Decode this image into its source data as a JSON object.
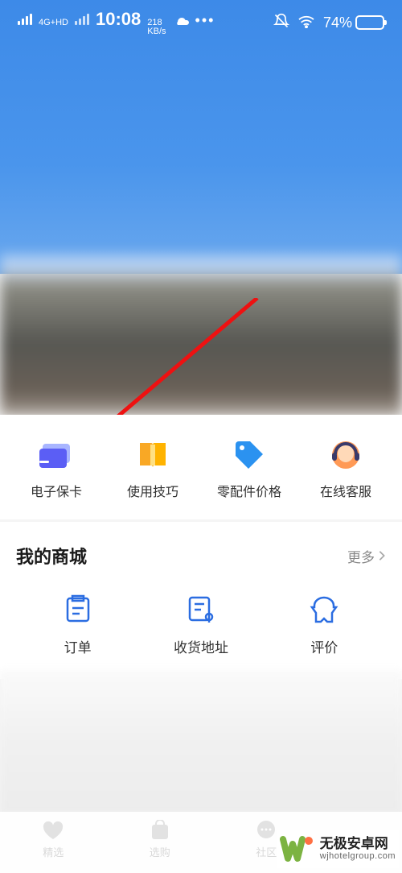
{
  "status": {
    "network_label": "4G+HD",
    "time": "10:08",
    "netspeed_value": "218",
    "netspeed_unit": "KB/s",
    "battery_label": "74%"
  },
  "quick_grid": [
    {
      "label": "电子保卡",
      "icon": "card-icon"
    },
    {
      "label": "使用技巧",
      "icon": "book-icon"
    },
    {
      "label": "零配件价格",
      "icon": "tag-icon"
    },
    {
      "label": "在线客服",
      "icon": "agent-icon"
    }
  ],
  "mall": {
    "title": "我的商城",
    "more_label": "更多",
    "items": [
      {
        "label": "订单",
        "icon": "order-icon"
      },
      {
        "label": "收货地址",
        "icon": "address-icon"
      },
      {
        "label": "评价",
        "icon": "review-icon"
      }
    ]
  },
  "tabs": [
    {
      "label": "精选",
      "icon": "heart-icon"
    },
    {
      "label": "选购",
      "icon": "bag-icon"
    },
    {
      "label": "社区",
      "icon": "chat-icon"
    }
  ],
  "watermark": {
    "title": "无极安卓网",
    "sub": "wjhotelgroup.com"
  },
  "colors": {
    "accent_blue": "#2b6de1",
    "header_blue": "#3d8ae8"
  }
}
